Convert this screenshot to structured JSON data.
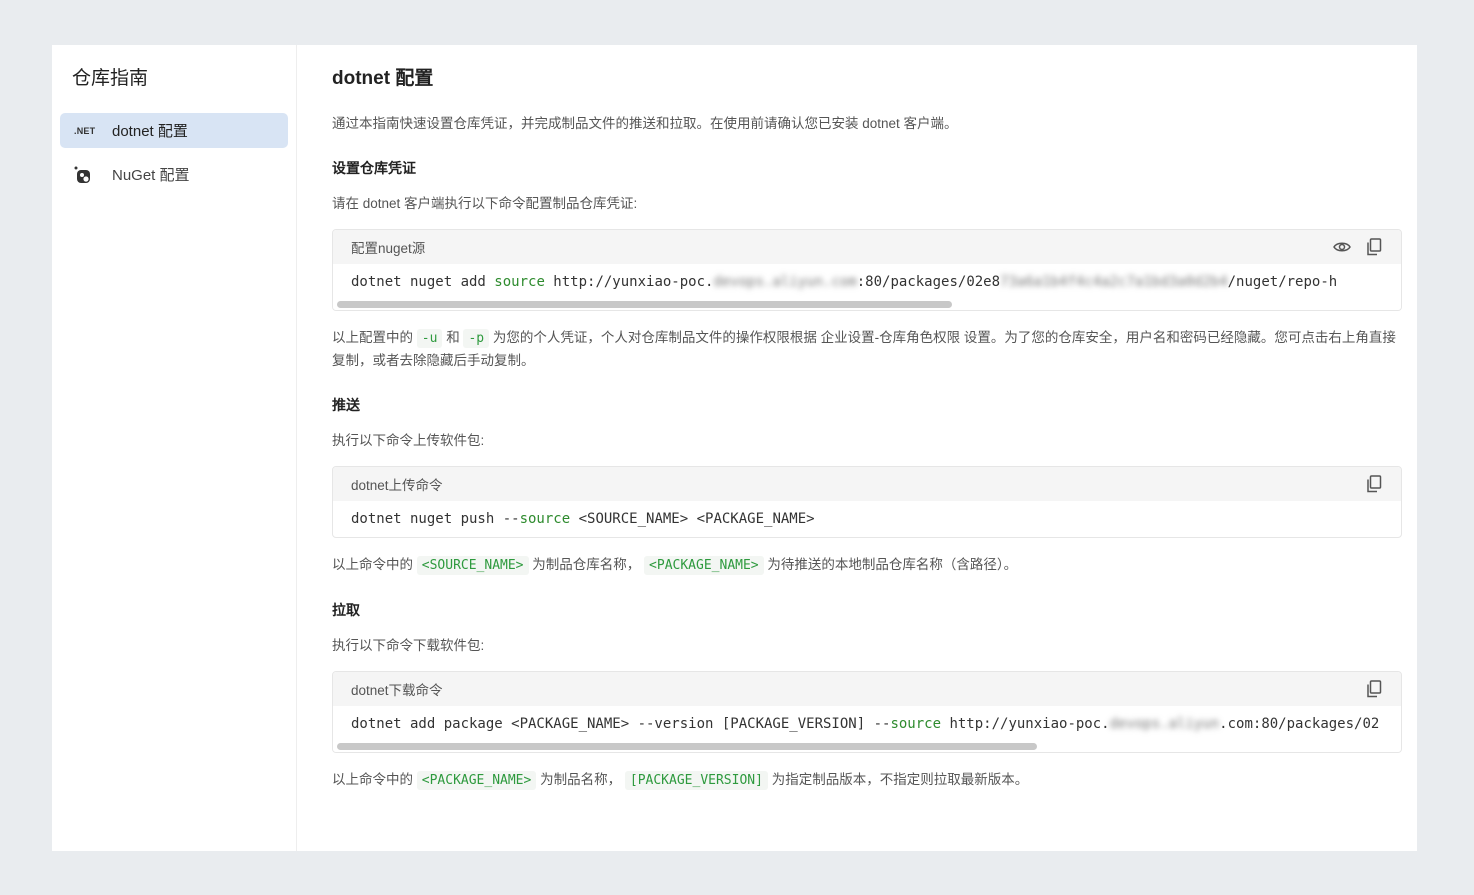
{
  "sidebar": {
    "title": "仓库指南",
    "items": [
      {
        "icon": "dotnet-icon",
        "badge": ".NET",
        "label": "dotnet 配置",
        "active": true
      },
      {
        "icon": "nuget-icon",
        "label": "NuGet 配置",
        "active": false
      }
    ]
  },
  "main": {
    "title": "dotnet 配置",
    "intro": "通过本指南快速设置仓库凭证，并完成制品文件的推送和拉取。在使用前请确认您已安装 dotnet 客户端。",
    "credentials": {
      "heading": "设置仓库凭证",
      "desc": "请在 dotnet 客户端执行以下命令配置制品仓库凭证:",
      "code_title": "配置nuget源",
      "code_prefix": "dotnet nuget add ",
      "code_kw": "source",
      "code_url_a": " http://yunxiao-poc.",
      "code_blur1": "devops.aliyun.com",
      "code_url_b": ":80/packages/02e8",
      "code_blur2": "73a6a1b4f4c4a2c7a1bd3a0d2b4",
      "code_url_c": "/nuget/repo-h",
      "note_a": "以上配置中的",
      "flag_u": "-u",
      "note_b": "和",
      "flag_p": "-p",
      "note_c": "为您的个人凭证，个人对仓库制品文件的操作权限根据 企业设置-仓库角色权限 设置。为了您的仓库安全，用户名和密码已经隐藏。您可点击右上角直接复制，或者去除隐藏后手动复制。",
      "scroll_fraction": 0.58
    },
    "push": {
      "heading": "推送",
      "desc": "执行以下命令上传软件包:",
      "code_title": "dotnet上传命令",
      "code_prefix": "dotnet nuget push --",
      "code_kw": "source",
      "code_suffix": " <SOURCE_NAME> <PACKAGE_NAME>",
      "note_a": "以上命令中的",
      "tag1": "<SOURCE_NAME>",
      "note_b": "为制品仓库名称，",
      "tag2": "<PACKAGE_NAME>",
      "note_c": "为待推送的本地制品仓库名称（含路径）。"
    },
    "pull": {
      "heading": "拉取",
      "desc": "执行以下命令下载软件包:",
      "code_title": "dotnet下载命令",
      "code_prefix": "dotnet add package <PACKAGE_NAME> --version [PACKAGE_VERSION] --",
      "code_kw": "source",
      "code_url_a": " http://yunxiao-poc.",
      "code_blur1": "devops.aliyun",
      "code_url_b": ".com:80/packages/02",
      "note_a": "以上命令中的",
      "tag1": "<PACKAGE_NAME>",
      "note_b": "为制品名称，",
      "tag2": "[PACKAGE_VERSION]",
      "note_c": "为指定制品版本，不指定则拉取最新版本。",
      "scroll_fraction": 0.66
    }
  },
  "colors": {
    "active_bg": "#d8e4f4",
    "keyword": "#2e8b2e",
    "inline_code": "#2e9a3e"
  }
}
